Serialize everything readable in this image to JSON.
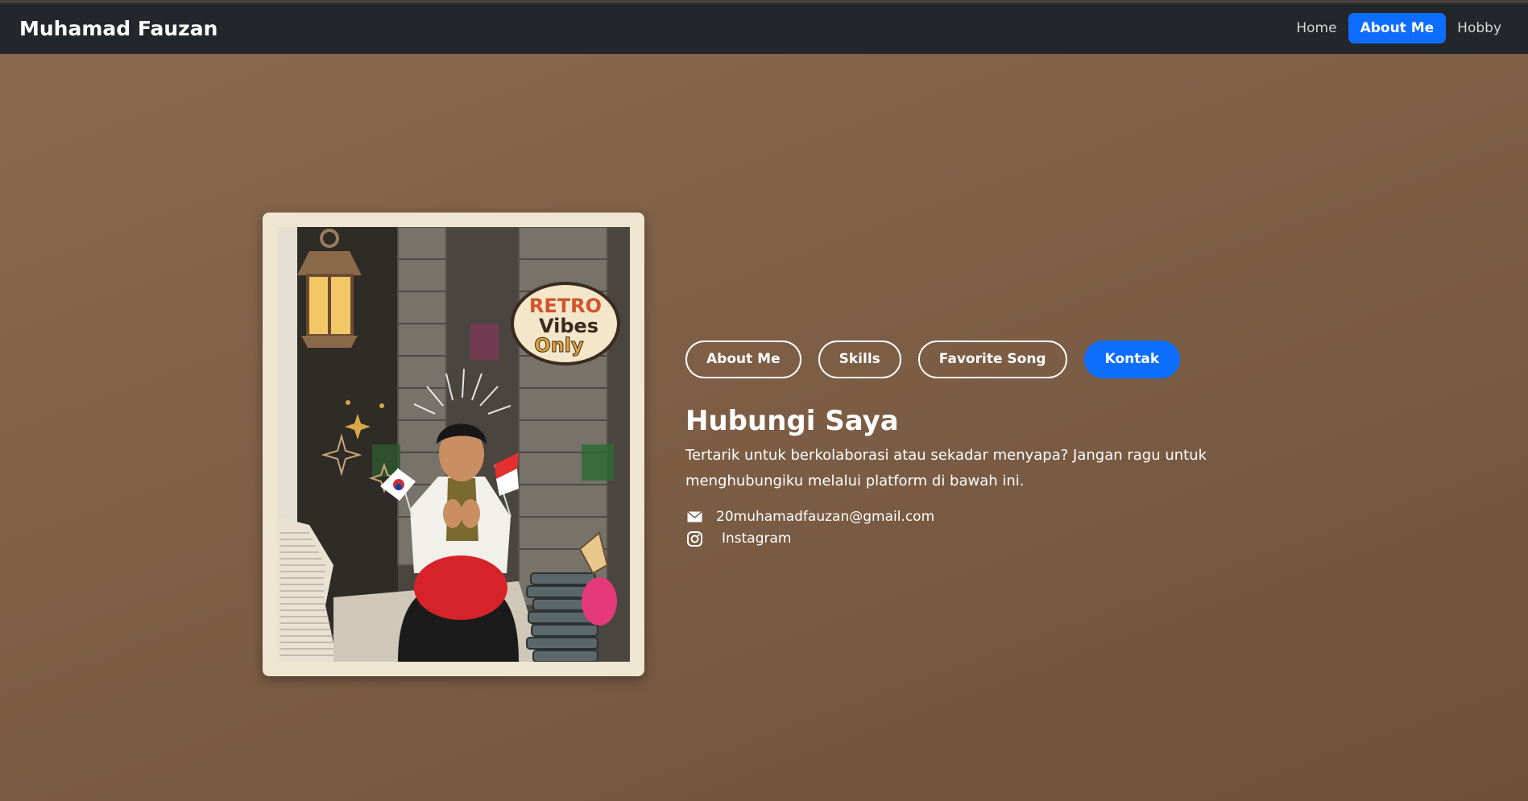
{
  "navbar": {
    "brand": "Muhamad Fauzan",
    "links": [
      {
        "label": "Home",
        "active": false
      },
      {
        "label": "About Me",
        "active": true
      },
      {
        "label": "Hobby",
        "active": false
      }
    ]
  },
  "profile": {
    "sticker_lines": [
      "RETRO",
      "Vibes",
      "Only"
    ]
  },
  "tabs": [
    {
      "label": "About Me",
      "active": false
    },
    {
      "label": "Skills",
      "active": false
    },
    {
      "label": "Favorite Song",
      "active": false
    },
    {
      "label": "Kontak",
      "active": true
    }
  ],
  "contact": {
    "title": "Hubungi Saya",
    "description": "Tertarik untuk berkolaborasi atau sekadar menyapa? Jangan ragu untuk menghubungiku melalui platform di bawah ini.",
    "email": "20muhamadfauzan@gmail.com",
    "instagram": "Instagram",
    "email_icon": "envelope-icon",
    "instagram_icon": "instagram-icon"
  },
  "colors": {
    "navbar_bg": "#23262b",
    "accent": "#0d6efd",
    "frame": "#efe6d2"
  }
}
